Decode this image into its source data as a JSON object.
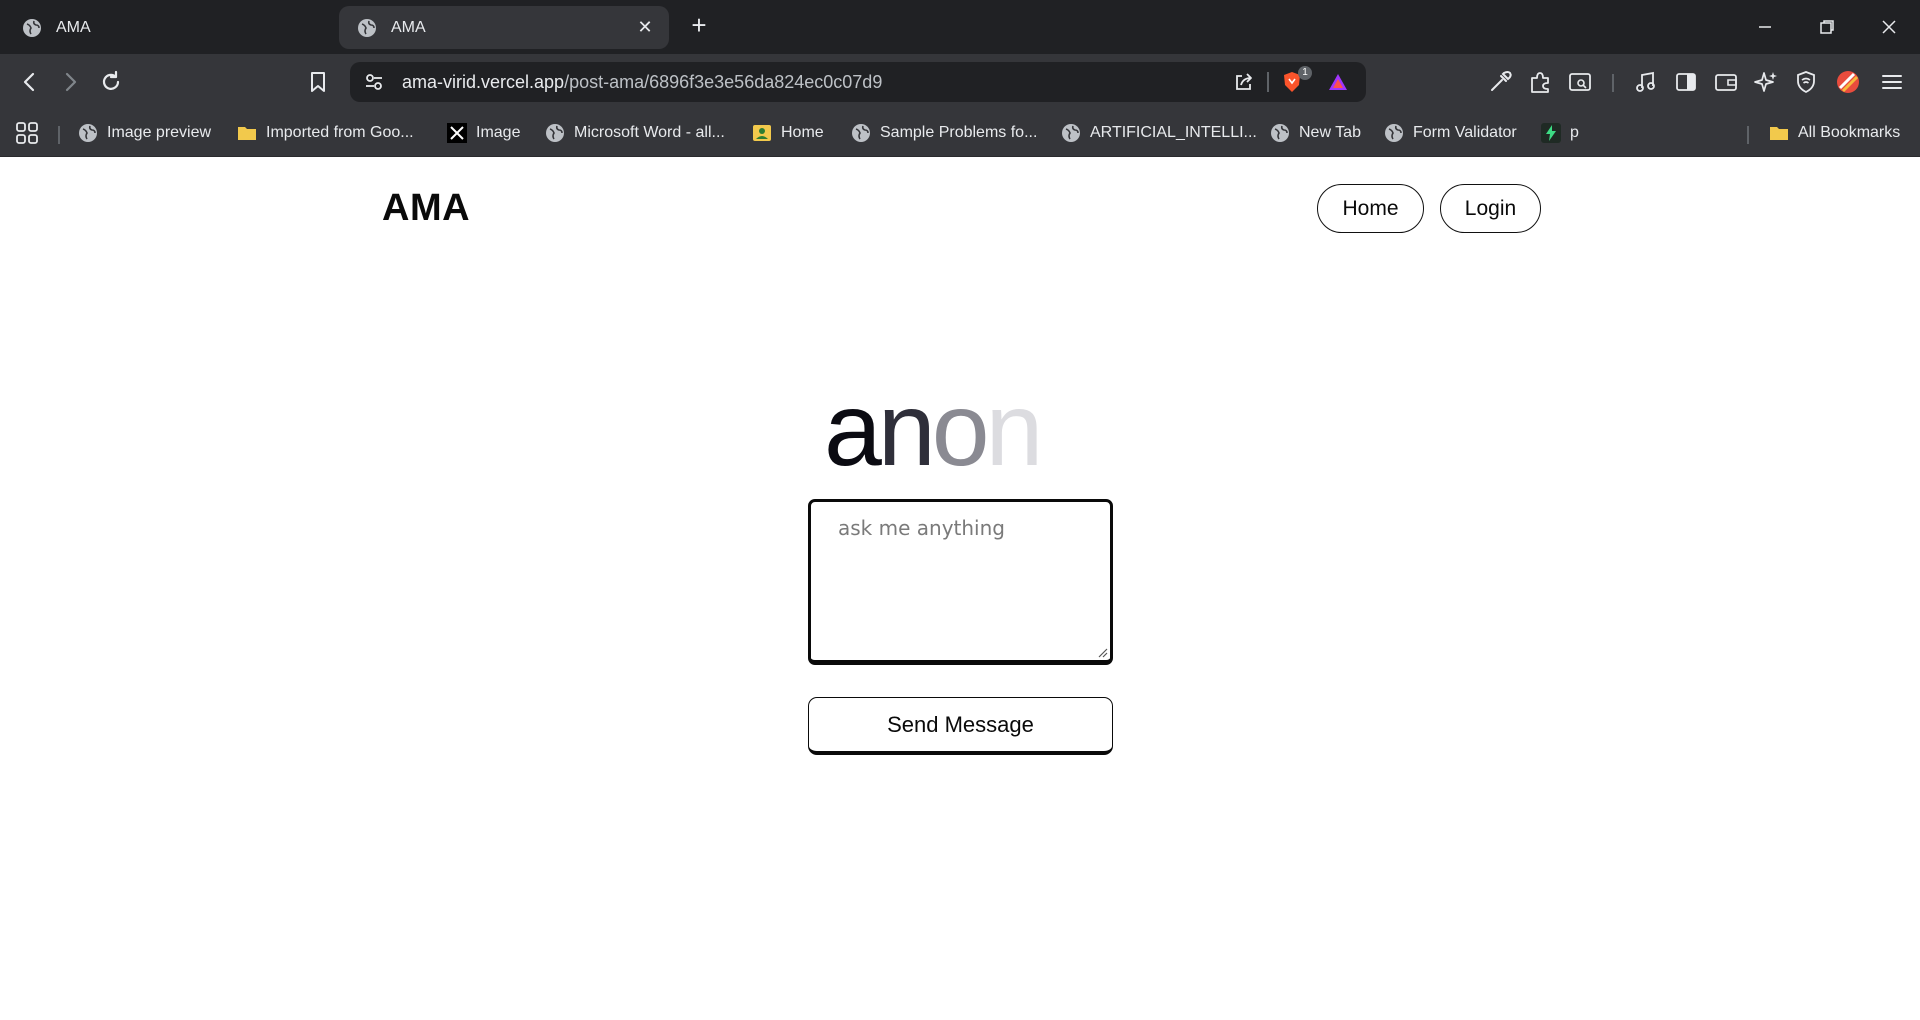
{
  "browser": {
    "tabs": [
      {
        "title": "AMA",
        "active": false
      },
      {
        "title": "AMA",
        "active": true
      }
    ],
    "url_host": "ama-virid.vercel.app",
    "url_path": "/post-ama/6896f3e3e56da824ec0c07d9",
    "shield_badge": "1",
    "bookmarks": [
      {
        "label": "Image preview",
        "icon": "globe-icon"
      },
      {
        "label": "Imported from Goo...",
        "icon": "folder-icon"
      },
      {
        "label": "Image",
        "icon": "x-logo-icon"
      },
      {
        "label": "Microsoft Word - all...",
        "icon": "globe-icon"
      },
      {
        "label": "Home",
        "icon": "image-icon"
      },
      {
        "label": "Sample Problems fo...",
        "icon": "globe-icon"
      },
      {
        "label": "ARTIFICIAL_INTELLI...",
        "icon": "globe-icon"
      },
      {
        "label": "New Tab",
        "icon": "globe-icon"
      },
      {
        "label": "Form Validator",
        "icon": "globe-icon"
      },
      {
        "label": "p",
        "icon": "bolt-icon"
      }
    ],
    "all_bookmarks_label": "All Bookmarks"
  },
  "site": {
    "logo": "AMA",
    "nav": {
      "home": "Home",
      "login": "Login"
    },
    "hero_word": "anon",
    "hero_letter_colors": [
      "#0b0b12",
      "#2f2f3a",
      "#8a8a92",
      "#dcdce0"
    ],
    "textarea_placeholder": "ask me anything",
    "send_label": "Send Message"
  }
}
